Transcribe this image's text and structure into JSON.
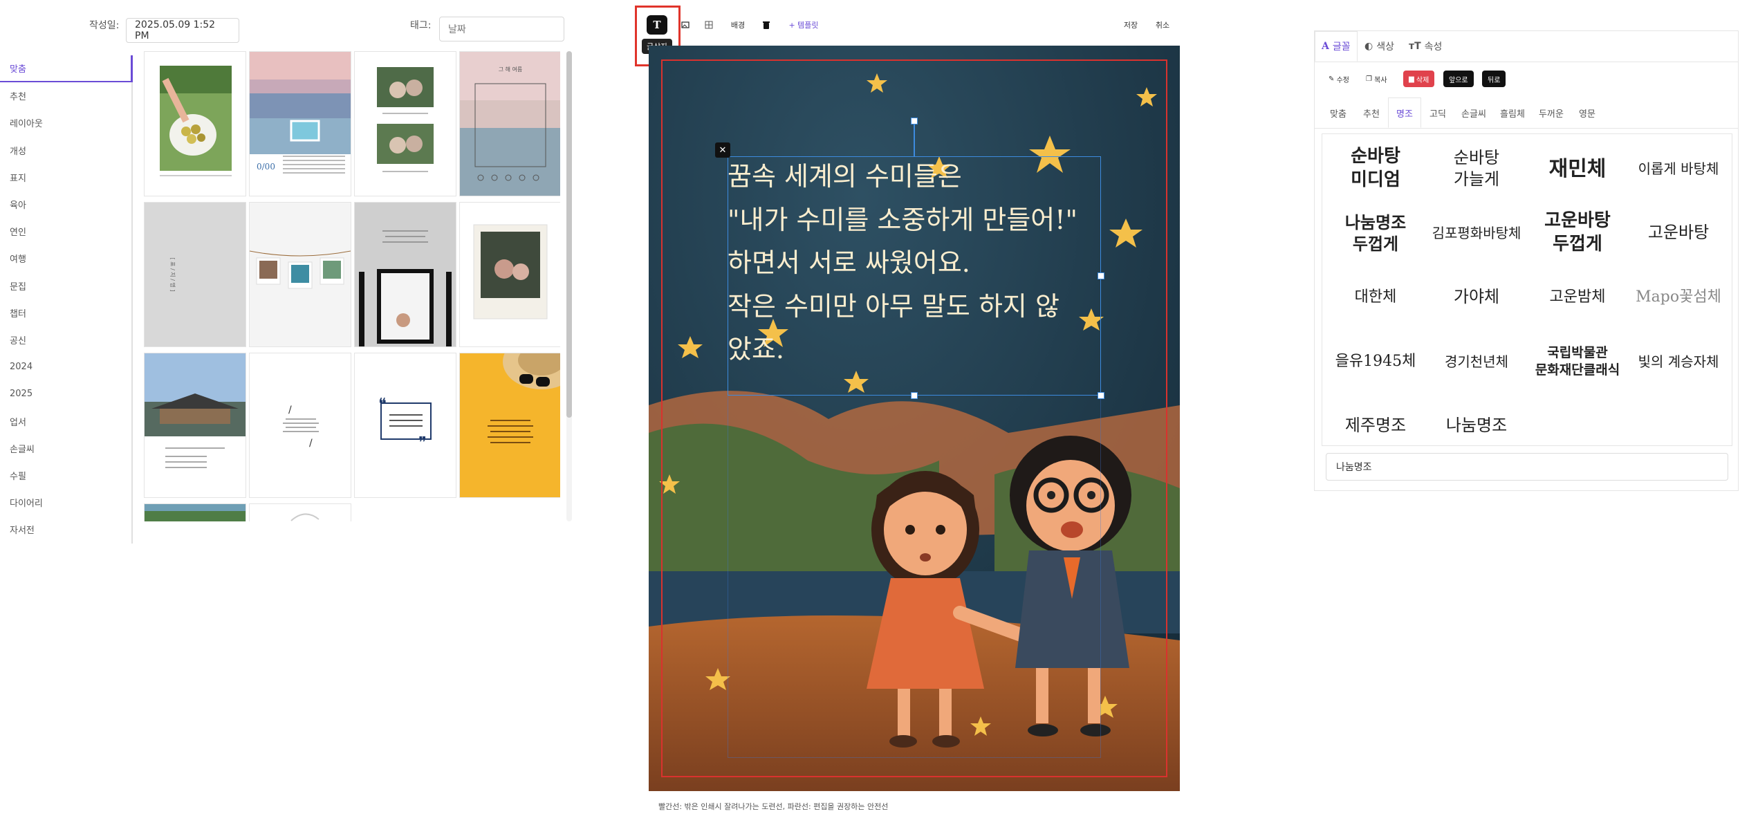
{
  "meta": {
    "date_label": "작성일:",
    "date_value": "2025.05.09 1:52 PM",
    "tag_label": "태그:",
    "tag_placeholder": "날짜"
  },
  "categories": [
    "맞춤",
    "추천",
    "레이아웃",
    "개성",
    "표지",
    "육아",
    "연인",
    "여행",
    "문집",
    "챕터",
    "공신",
    "2024",
    "2025",
    "업서",
    "손글씨",
    "수필",
    "다이어리",
    "자서전"
  ],
  "active_category": "맞춤",
  "thumbnails": {
    "t1_caption": "",
    "t2_title": "0/00",
    "t4_title": "그 해 여름",
    "t5_text": "[ 표 / 지 / 명 ]",
    "t10_slash": "/",
    "t11_quote_open": "❝",
    "t11_quote_close": "❞"
  },
  "toolbar": {
    "text_tool": "T",
    "text_tool_tooltip": "글상자",
    "background": "배경",
    "add_template": "+ 템플릿",
    "save": "저장",
    "cancel": "취소"
  },
  "canvas": {
    "story_lines": [
      "꿈속 세계의 수미들은",
      "\"내가 수미를 소중하게 만들어!\"",
      "하면서 서로 싸웠어요.",
      "작은 수미만 아무 말도 하지 않",
      "았죠."
    ]
  },
  "footnote": "빨간선: 밖은 인쇄시 잘려나가는 도련선, 파란선: 편집을 권장하는 안전선",
  "panel": {
    "tabs": [
      "글꼴",
      "색상",
      "속성"
    ],
    "actions": {
      "edit": "수정",
      "copy": "복사",
      "delete": "삭제",
      "front": "앞으로",
      "back": "뒤로"
    },
    "font_tabs": [
      "맞춤",
      "추천",
      "명조",
      "고딕",
      "손글씨",
      "흘림체",
      "두꺼운",
      "영문"
    ],
    "active_font_tab": "명조",
    "fonts": [
      "순바탕\n미디엄",
      "순바탕\n가늘게",
      "재민체",
      "이롭게 바탕체",
      "나눔명조\n두껍게",
      "김포평화바탕체",
      "고운바탕\n두껍게",
      "고운바탕",
      "대한체",
      "가야체",
      "고운밤체",
      "Mapo꽃섬체",
      "을유1945체",
      "경기천년체",
      "국립박물관\n문화재단클래식",
      "빛의 계승자체",
      "제주명조",
      "나눔명조"
    ],
    "selected_font": "나눔명조"
  },
  "colors": {
    "accent": "#6a4bd6",
    "delete": "#e0424c",
    "guide_red": "#d9322e",
    "guide_blue": "#3d8bdf"
  }
}
